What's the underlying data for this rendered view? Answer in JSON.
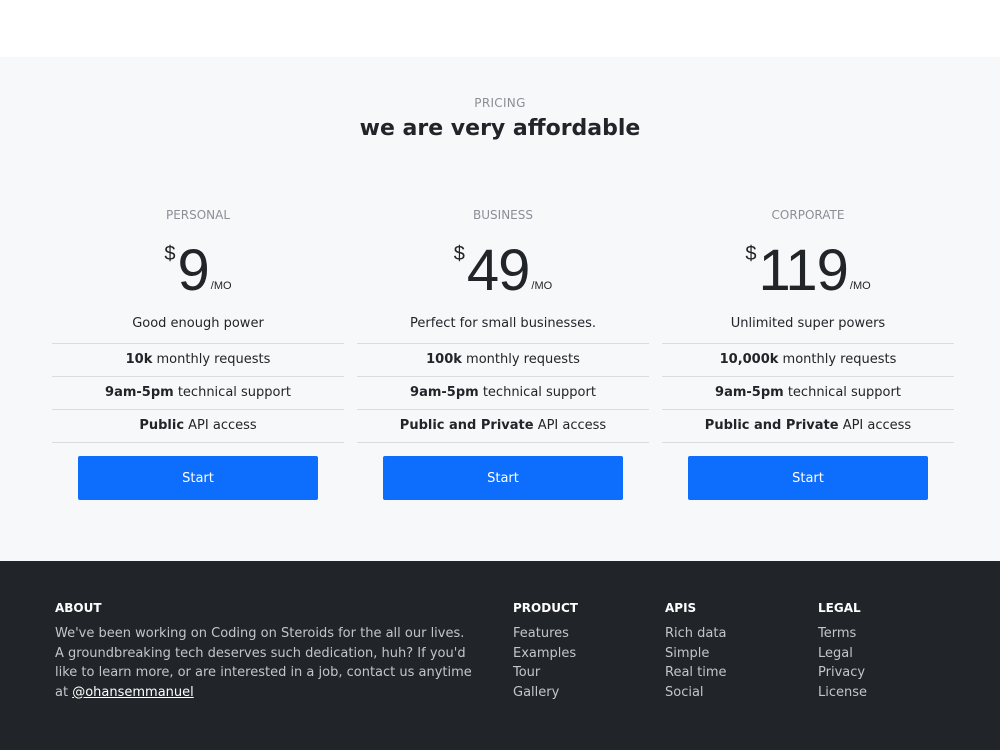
{
  "pricing": {
    "eyebrow": "PRICING",
    "heading": "we are very affordable",
    "plans": [
      {
        "name": "PERSONAL",
        "currency": "$",
        "amount": "9",
        "per": "/MO",
        "description": "Good enough power",
        "features": [
          {
            "bold": "10k",
            "rest": " monthly requests"
          },
          {
            "bold": "9am-5pm",
            "rest": " technical support"
          },
          {
            "bold": "Public",
            "rest": " API access"
          }
        ],
        "button": "Start"
      },
      {
        "name": "BUSINESS",
        "currency": "$",
        "amount": "49",
        "per": "/MO",
        "description": "Perfect for small businesses.",
        "features": [
          {
            "bold": "100k",
            "rest": " monthly requests"
          },
          {
            "bold": "9am-5pm",
            "rest": " technical support"
          },
          {
            "bold": "Public and Private",
            "rest": " API access"
          }
        ],
        "button": "Start"
      },
      {
        "name": "CORPORATE",
        "currency": "$",
        "amount": "119",
        "per": "/MO",
        "description": "Unlimited super powers",
        "features": [
          {
            "bold": "10,000k",
            "rest": " monthly requests"
          },
          {
            "bold": "9am-5pm",
            "rest": " technical support"
          },
          {
            "bold": "Public and Private",
            "rest": " API access"
          }
        ],
        "button": "Start"
      }
    ]
  },
  "footer": {
    "about": {
      "title": "ABOUT",
      "text": "We've been working on Coding on Steroids for the all our lives. A groundbreaking tech deserves such dedication, huh? If you'd like to learn more, or are interested in a job, contact us anytime at ",
      "link": "@ohansemmanuel"
    },
    "product": {
      "title": "PRODUCT",
      "links": [
        "Features",
        "Examples",
        "Tour",
        "Gallery"
      ]
    },
    "apis": {
      "title": "APIS",
      "links": [
        "Rich data",
        "Simple",
        "Real time",
        "Social"
      ]
    },
    "legal": {
      "title": "LEGAL",
      "links": [
        "Terms",
        "Legal",
        "Privacy",
        "License"
      ]
    }
  },
  "colors": {
    "accent": "#0d6efd",
    "pricing_bg": "#f7f8fa",
    "footer_bg": "#212429"
  }
}
